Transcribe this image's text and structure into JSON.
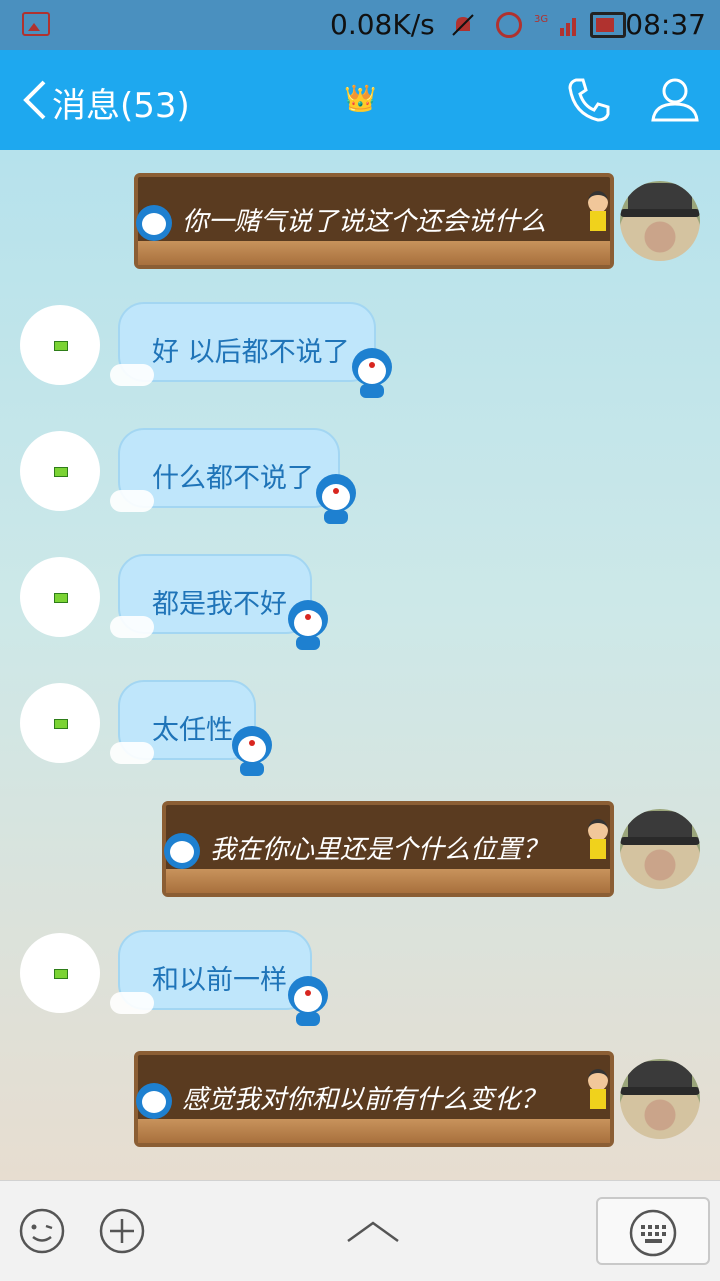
{
  "status_bar": {
    "net_speed": "0.08K/s",
    "time": "08:37",
    "network": "3G"
  },
  "header": {
    "back_label": "消息(53)"
  },
  "messages": [
    {
      "side": "right",
      "text": "你一赌气说了说这个还会说什么"
    },
    {
      "side": "left",
      "text": "好 以后都不说了"
    },
    {
      "side": "left",
      "text": "什么都不说了"
    },
    {
      "side": "left",
      "text": "都是我不好"
    },
    {
      "side": "left",
      "text": "太任性"
    },
    {
      "side": "right",
      "text": "我在你心里还是个什么位置？"
    },
    {
      "side": "left",
      "text": "和以前一样"
    },
    {
      "side": "right",
      "text": "感觉我对你和以前有什么变化？"
    }
  ],
  "icons": {
    "gallery": "picture-icon",
    "mute": "bell-off-icon",
    "alarm": "alarm-clock-icon",
    "battery": "battery-icon",
    "back": "chevron-left-icon",
    "crown": "crown-icon",
    "phone": "phone-icon",
    "profile": "person-icon",
    "emoji": "smiley-icon",
    "add": "plus-icon",
    "expand": "chevron-up-icon",
    "keyboard": "keyboard-icon"
  },
  "colors": {
    "header": "#1ea8ef",
    "status_bar": "#4a90bf",
    "bubble": "#bfe6fb",
    "bubble_text": "#1f74b8",
    "board": "#5a3b20"
  }
}
